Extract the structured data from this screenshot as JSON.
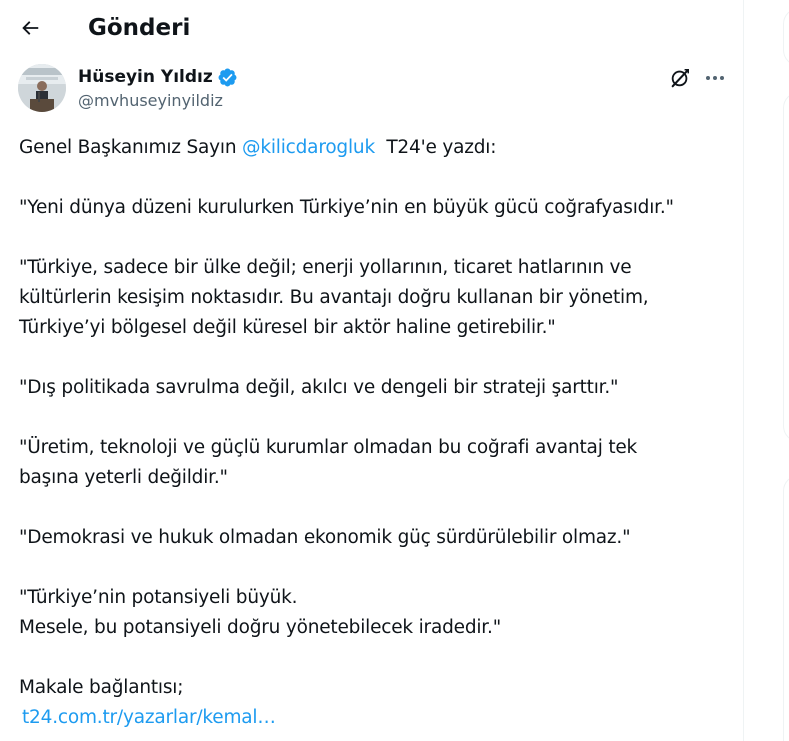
{
  "header": {
    "title": "Gönderi",
    "back_icon": "arrow-left-icon"
  },
  "author": {
    "name": "Hüseyin Yıldız",
    "handle": "@mvhuseyinyildiz",
    "verified": true,
    "verified_color": "#1d9bf0"
  },
  "actions": {
    "grok_icon": "grok-icon",
    "more_icon": "more-horizontal-icon"
  },
  "tweet": {
    "intro_before": "Genel Başkanımız Sayın ",
    "intro_mention": "@kilicdarogluk",
    "intro_after": "  T24'e yazdı:",
    "p1": "\"Yeni dünya düzeni kurulurken Türkiye’nin en büyük gücü coğrafyasıdır.\"",
    "p2_l1": "\"Türkiye, sadece bir ülke değil; enerji yollarının, ticaret hatlarının ve",
    "p2_l2": "kültürlerin kesişim noktasıdır. Bu avantajı doğru kullanan bir yönetim,",
    "p2_l3": "Türkiye’yi bölgesel değil küresel bir aktör haline getirebilir.\"",
    "p3": "\"Dış politikada savrulma değil, akılcı ve dengeli bir strateji şarttır.\"",
    "p4_l1": "\"Üretim, teknoloji ve güçlü kurumlar olmadan bu coğrafi avantaj tek",
    "p4_l2": "başına yeterli değildir.\"",
    "p5": "\"Demokrasi ve hukuk olmadan ekonomik güç sürdürülebilir olmaz.\"",
    "p6_l1": "\"Türkiye’nin potansiyeli büyük.",
    "p6_l2": "Mesele, bu potansiyeli doğru yönetebilecek iradedir.\"",
    "p7_l1": "Makale bağlantısı;",
    "link": "t24.com.tr/yazarlar/kemal…",
    "link_color": "#1d9bf0"
  }
}
